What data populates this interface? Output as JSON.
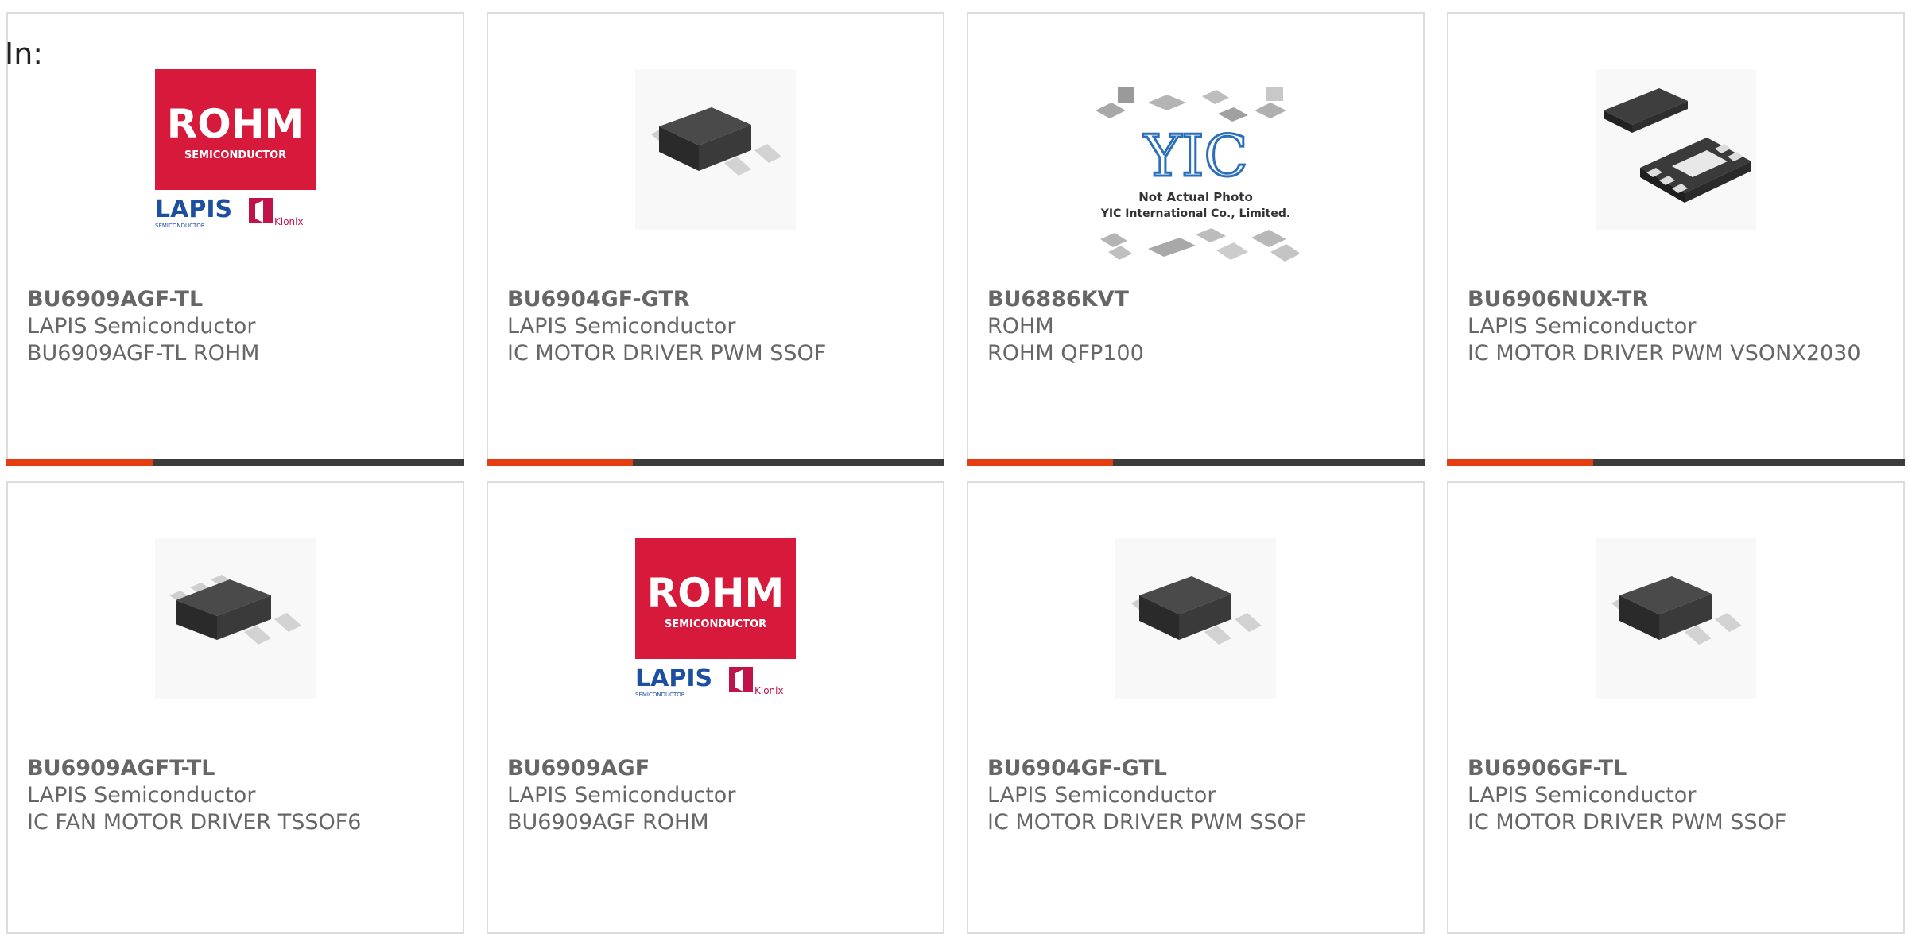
{
  "filter_label": "In:",
  "products": [
    {
      "part": "BU6909AGF-TL",
      "manufacturer": "LAPIS Semiconductor",
      "description": "BU6909AGF-TL ROHM",
      "image": "rohm-lapis-logo"
    },
    {
      "part": "BU6904GF-GTR",
      "manufacturer": "LAPIS Semiconductor",
      "description": "IC MOTOR DRIVER PWM SSOF",
      "image": "chip-sot-package"
    },
    {
      "part": "BU6886KVT",
      "manufacturer": "ROHM",
      "description": "ROHM QFP100",
      "image": "yic-placeholder"
    },
    {
      "part": "BU6906NUX-TR",
      "manufacturer": "LAPIS Semiconductor",
      "description": "IC MOTOR DRIVER PWM VSONX2030",
      "image": "chip-son-package"
    },
    {
      "part": "BU6909AGFT-TL",
      "manufacturer": "LAPIS Semiconductor",
      "description": "IC FAN MOTOR DRIVER TSSOF6",
      "image": "chip-sot6-package"
    },
    {
      "part": "BU6909AGF",
      "manufacturer": "LAPIS Semiconductor",
      "description": "BU6909AGF ROHM",
      "image": "rohm-lapis-logo"
    },
    {
      "part": "BU6904GF-GTL",
      "manufacturer": "LAPIS Semiconductor",
      "description": "IC MOTOR DRIVER PWM SSOF",
      "image": "chip-sot-package"
    },
    {
      "part": "BU6906GF-TL",
      "manufacturer": "LAPIS Semiconductor",
      "description": "IC MOTOR DRIVER PWM SSOF",
      "image": "chip-sot-package"
    }
  ],
  "logo": {
    "brand": "ROHM",
    "brand_sub": "SEMICONDUCTOR",
    "lapis": "LAPIS",
    "lapis_sub": "SEMICONDUCTOR",
    "kionix": "Kionix"
  },
  "yic": {
    "mark": "YIC",
    "line1": "Not Actual Photo",
    "line2": "YIC International Co., Limited."
  },
  "colors": {
    "accent": "#e63d12",
    "bar": "#3c3c3c",
    "rohm_red": "#d7193b",
    "text": "#666666"
  }
}
